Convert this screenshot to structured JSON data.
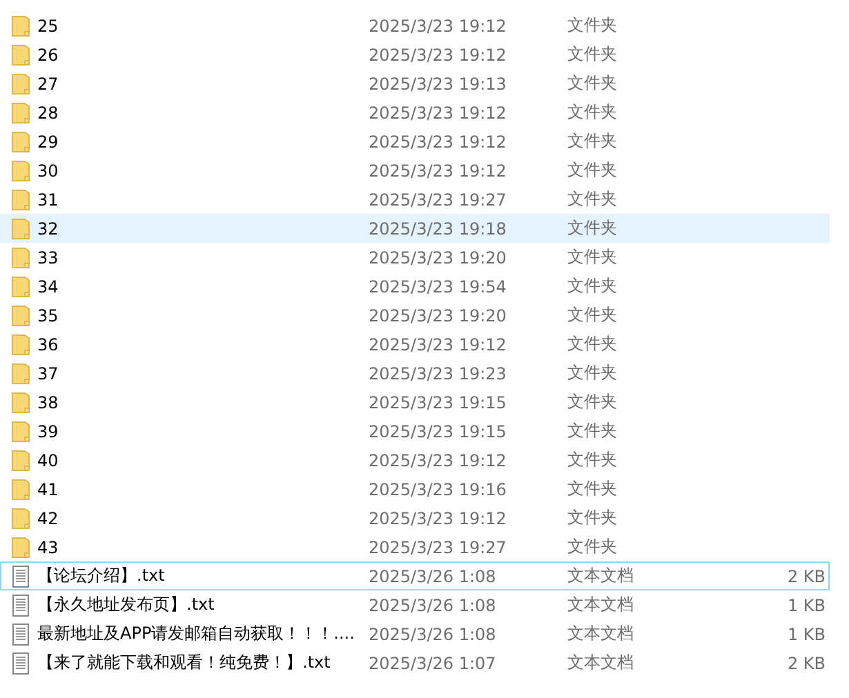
{
  "file_list": [
    {
      "kind": "folder",
      "name": "25",
      "date": "2025/3/23 19:12",
      "type": "文件夹",
      "selected": false,
      "focused": false
    },
    {
      "kind": "folder",
      "name": "26",
      "date": "2025/3/23 19:12",
      "type": "文件夹",
      "selected": false,
      "focused": false
    },
    {
      "kind": "folder",
      "name": "27",
      "date": "2025/3/23 19:13",
      "type": "文件夹",
      "selected": false,
      "focused": false
    },
    {
      "kind": "folder",
      "name": "28",
      "date": "2025/3/23 19:12",
      "type": "文件夹",
      "selected": false,
      "focused": false
    },
    {
      "kind": "folder",
      "name": "29",
      "date": "2025/3/23 19:12",
      "type": "文件夹",
      "selected": false,
      "focused": false
    },
    {
      "kind": "folder",
      "name": "30",
      "date": "2025/3/23 19:12",
      "type": "文件夹",
      "selected": false,
      "focused": false
    },
    {
      "kind": "folder",
      "name": "31",
      "date": "2025/3/23 19:27",
      "type": "文件夹",
      "selected": false,
      "focused": false
    },
    {
      "kind": "folder",
      "name": "32",
      "date": "2025/3/23 19:18",
      "type": "文件夹",
      "selected": true,
      "focused": false
    },
    {
      "kind": "folder",
      "name": "33",
      "date": "2025/3/23 19:20",
      "type": "文件夹",
      "selected": false,
      "focused": false
    },
    {
      "kind": "folder",
      "name": "34",
      "date": "2025/3/23 19:54",
      "type": "文件夹",
      "selected": false,
      "focused": false
    },
    {
      "kind": "folder",
      "name": "35",
      "date": "2025/3/23 19:20",
      "type": "文件夹",
      "selected": false,
      "focused": false
    },
    {
      "kind": "folder",
      "name": "36",
      "date": "2025/3/23 19:12",
      "type": "文件夹",
      "selected": false,
      "focused": false
    },
    {
      "kind": "folder",
      "name": "37",
      "date": "2025/3/23 19:23",
      "type": "文件夹",
      "selected": false,
      "focused": false
    },
    {
      "kind": "folder",
      "name": "38",
      "date": "2025/3/23 19:15",
      "type": "文件夹",
      "selected": false,
      "focused": false
    },
    {
      "kind": "folder",
      "name": "39",
      "date": "2025/3/23 19:15",
      "type": "文件夹",
      "selected": false,
      "focused": false
    },
    {
      "kind": "folder",
      "name": "40",
      "date": "2025/3/23 19:12",
      "type": "文件夹",
      "selected": false,
      "focused": false
    },
    {
      "kind": "folder",
      "name": "41",
      "date": "2025/3/23 19:16",
      "type": "文件夹",
      "selected": false,
      "focused": false
    },
    {
      "kind": "folder",
      "name": "42",
      "date": "2025/3/23 19:12",
      "type": "文件夹",
      "selected": false,
      "focused": false
    },
    {
      "kind": "folder",
      "name": "43",
      "date": "2025/3/23 19:27",
      "type": "文件夹",
      "selected": false,
      "focused": false
    },
    {
      "kind": "file",
      "name": "【论坛介绍】.txt",
      "date": "2025/3/26 1:08",
      "type": "文本文档",
      "size": "2 KB",
      "selected": false,
      "focused": true
    },
    {
      "kind": "file",
      "name": "【永久地址发布页】.txt",
      "date": "2025/3/26 1:08",
      "type": "文本文档",
      "size": "1 KB",
      "selected": false,
      "focused": false
    },
    {
      "kind": "file",
      "name": "最新地址及APP请发邮箱自动获取！！！....",
      "date": "2025/3/26 1:08",
      "type": "文本文档",
      "size": "1 KB",
      "selected": false,
      "focused": false
    },
    {
      "kind": "file",
      "name": "【来了就能下载和观看！纯免费！】.txt",
      "date": "2025/3/26 1:07",
      "type": "文本文档",
      "size": "2 KB",
      "selected": false,
      "focused": false
    }
  ]
}
